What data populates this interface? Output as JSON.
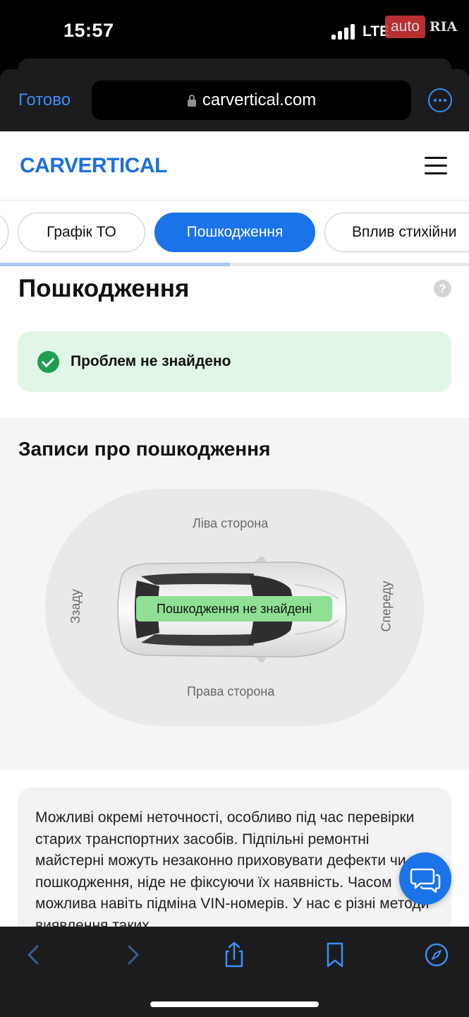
{
  "status_bar": {
    "time": "15:57",
    "network": "LTE",
    "watermark_auto": "auto",
    "watermark_ria": "RIA"
  },
  "browser": {
    "done_label": "Готово",
    "url": "carvertical.com",
    "more_icon": "ellipsis-circle-icon",
    "lock_icon": "lock-icon"
  },
  "site": {
    "logo_text": "CARVERTICAL",
    "menu_icon": "hamburger-icon",
    "brand_color": "#1a73e8"
  },
  "tabs": [
    {
      "label": "Графік ТО",
      "active": false
    },
    {
      "label": "Пошкодження",
      "active": true
    },
    {
      "label": "Вплив стихійни",
      "active": false
    }
  ],
  "tabs_scroll_progress": 0.49,
  "damage": {
    "title": "Пошкодження",
    "help": "?",
    "status": "Проблем не знайдено",
    "status_color": "#1f9e50"
  },
  "records": {
    "title": "Записи про пошкодження",
    "left_side": "Ліва сторона",
    "right_side": "Права сторона",
    "rear": "Ззаду",
    "front": "Спереду",
    "no_damage": "Пошкодження не знайдені"
  },
  "disclaimer": {
    "text": "Можливі окремі неточності, особливо під час перевірки старих транспортних засобів. Підпільні ремонтні майстерні можуть незаконно приховувати дефекти чи пошкодження, ніде не фіксуючи їх наявність. Часом можлива навіть підміна VIN-номерів. У нас є різні методи виявлення таких"
  },
  "toolbar": {
    "back_icon": "chevron-left-icon",
    "forward_icon": "chevron-right-icon",
    "share_icon": "share-icon",
    "bookmarks_icon": "bookmark-icon",
    "tabs_icon": "compass-icon"
  }
}
